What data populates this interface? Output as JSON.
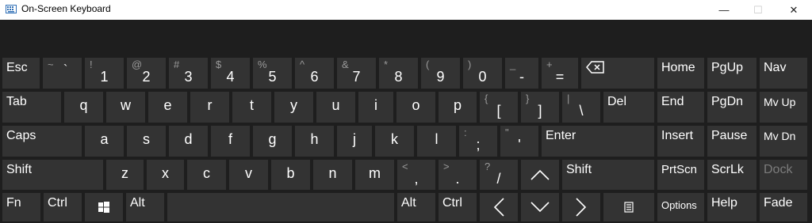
{
  "window": {
    "title": "On-Screen Keyboard",
    "minimize": "—",
    "maximize": "☐",
    "close": "✕"
  },
  "rows": {
    "row1": [
      "Esc",
      "~",
      "`",
      "!",
      "1",
      "@",
      "2",
      "#",
      "3",
      "$",
      "4",
      "%",
      "5",
      "^",
      "6",
      "&",
      "7",
      "*",
      "8",
      "(",
      "9",
      ")",
      "0",
      "_",
      "-",
      "+",
      "="
    ],
    "row2": [
      "Tab",
      "q",
      "w",
      "e",
      "r",
      "t",
      "y",
      "u",
      "i",
      "o",
      "p",
      "{",
      "[",
      "}",
      "]",
      "|",
      "\\",
      "Del"
    ],
    "row3": [
      "Caps",
      "a",
      "s",
      "d",
      "f",
      "g",
      "h",
      "j",
      "k",
      "l",
      ":",
      ";",
      "\"",
      "'",
      "Enter"
    ],
    "row4": [
      "Shift",
      "z",
      "x",
      "c",
      "v",
      "b",
      "n",
      "m",
      "<",
      ",",
      ">",
      ".",
      "?",
      "/",
      "Shift"
    ],
    "row5": [
      "Fn",
      "Ctrl",
      "Alt",
      "Alt",
      "Ctrl"
    ]
  },
  "nav": {
    "home": "Home",
    "pgup": "PgUp",
    "nav": "Nav",
    "end": "End",
    "pgdn": "PgDn",
    "mvup": "Mv Up",
    "insert": "Insert",
    "pause": "Pause",
    "mvdn": "Mv Dn",
    "prtscn": "PrtScn",
    "scrlk": "ScrLk",
    "dock": "Dock",
    "options": "Options",
    "help": "Help",
    "fade": "Fade"
  },
  "icons": {
    "app": "keyboard-icon",
    "backspace": "backspace-icon",
    "windows": "windows-logo-icon",
    "menu": "context-menu-icon",
    "arrows": [
      "arrow-up-icon",
      "arrow-left-icon",
      "arrow-down-icon",
      "arrow-right-icon"
    ]
  },
  "colors": {
    "key": "#333333",
    "background": "#1e1e1e",
    "text": "#ffffff",
    "secondary": "#9a9a9a",
    "titlebar": "#ffffff"
  }
}
